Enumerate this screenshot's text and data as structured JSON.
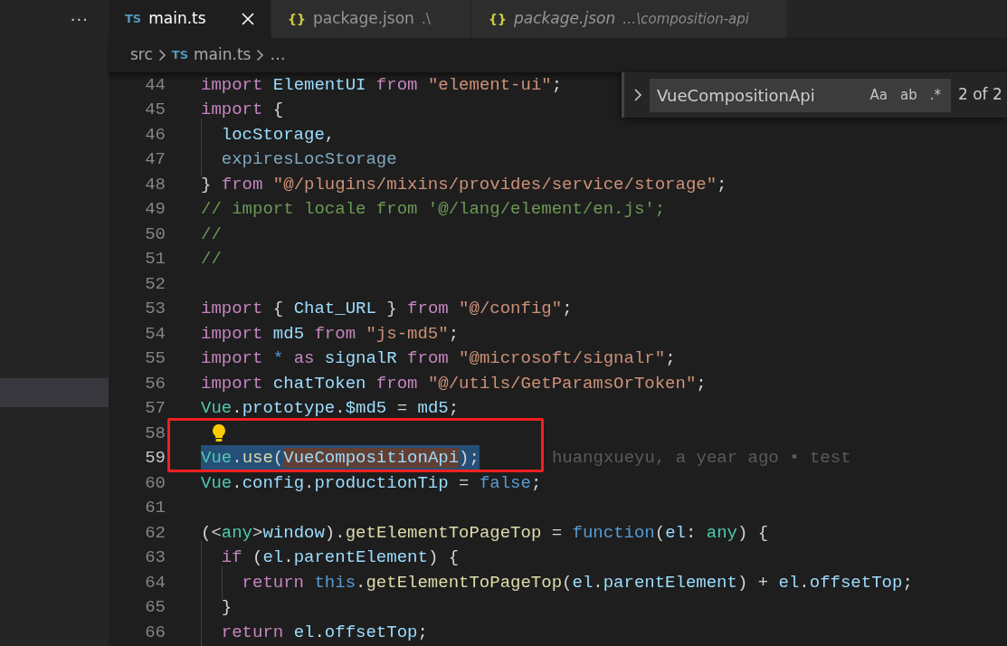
{
  "activity": {
    "more_actions": "···"
  },
  "tabs": [
    {
      "badge": {
        "text": "TS",
        "kind": "ts"
      },
      "label": "main.ts",
      "selected": true,
      "preview": false
    },
    {
      "badge": {
        "text": "{}",
        "kind": "json"
      },
      "label": "package.json",
      "description": ".\\",
      "selected": false,
      "preview": false
    },
    {
      "badge": {
        "text": "{}",
        "kind": "json"
      },
      "label": "package.json",
      "description": "…\\composition-api",
      "selected": false,
      "preview": true
    }
  ],
  "breadcrumb": [
    {
      "label": "src"
    },
    {
      "badge": {
        "text": "TS",
        "kind": "ts"
      },
      "label": "main.ts"
    },
    {
      "label": "…"
    }
  ],
  "find": {
    "value": "VueCompositionApi",
    "toggles": [
      {
        "label": "Aa",
        "on": false
      },
      {
        "label": "ab",
        "on": false
      },
      {
        "label": ".*",
        "on": false
      }
    ],
    "count": "2 of 2"
  },
  "lines": [
    {
      "number": "44",
      "selected": false,
      "boxed": false,
      "tokens": [
        {
          "t": "import ",
          "kind": "kw"
        },
        {
          "t": "ElementUI ",
          "kind": "var"
        },
        {
          "t": "from ",
          "kind": "kw"
        },
        {
          "t": "\"element-ui\"",
          "kind": "str"
        },
        {
          "t": ";",
          "kind": "p"
        }
      ]
    },
    {
      "number": "45",
      "selected": false,
      "boxed": false,
      "tokens": [
        {
          "t": "import",
          "kind": "kw"
        },
        {
          "t": " {",
          "kind": "p"
        }
      ]
    },
    {
      "number": "46",
      "selected": false,
      "boxed": false,
      "tokens": [
        {
          "t": "  locStorage",
          "kind": "var"
        },
        {
          "t": ",",
          "kind": "p"
        }
      ]
    },
    {
      "number": "47",
      "selected": false,
      "boxed": false,
      "tokens": [
        {
          "t": "  expiresLocStorage",
          "kind": "dim"
        }
      ]
    },
    {
      "number": "48",
      "selected": false,
      "boxed": false,
      "tokens": [
        {
          "t": "} ",
          "kind": "p"
        },
        {
          "t": "from ",
          "kind": "kw"
        },
        {
          "t": "\"@/plugins/mixins/provides/service/storage\"",
          "kind": "str"
        },
        {
          "t": ";",
          "kind": "p"
        }
      ]
    },
    {
      "number": "49",
      "selected": false,
      "boxed": false,
      "tokens": [
        {
          "t": "// import locale from '@/lang/element/en.js';",
          "kind": "com"
        }
      ]
    },
    {
      "number": "50",
      "selected": false,
      "boxed": false,
      "tokens": [
        {
          "t": "//",
          "kind": "com"
        }
      ]
    },
    {
      "number": "51",
      "selected": false,
      "boxed": false,
      "tokens": [
        {
          "t": "//",
          "kind": "com"
        }
      ]
    },
    {
      "number": "52",
      "selected": false,
      "boxed": false
    },
    {
      "number": "53",
      "selected": false,
      "boxed": false,
      "tokens": [
        {
          "t": "import",
          "kind": "kw"
        },
        {
          "t": " { ",
          "kind": "p"
        },
        {
          "t": "Chat_URL",
          "kind": "var"
        },
        {
          "t": " } ",
          "kind": "p"
        },
        {
          "t": "from ",
          "kind": "kw"
        },
        {
          "t": "\"@/config\"",
          "kind": "str"
        },
        {
          "t": ";",
          "kind": "p"
        }
      ]
    },
    {
      "number": "54",
      "selected": false,
      "boxed": false,
      "tokens": [
        {
          "t": "import ",
          "kind": "kw"
        },
        {
          "t": "md5 ",
          "kind": "var"
        },
        {
          "t": "from ",
          "kind": "kw"
        },
        {
          "t": "\"js-md5\"",
          "kind": "str"
        },
        {
          "t": ";",
          "kind": "p"
        }
      ]
    },
    {
      "number": "55",
      "selected": false,
      "boxed": false,
      "tokens": [
        {
          "t": "import ",
          "kind": "kw"
        },
        {
          "t": "* ",
          "kind": "kw2"
        },
        {
          "t": "as ",
          "kind": "kw"
        },
        {
          "t": "signalR ",
          "kind": "var"
        },
        {
          "t": "from ",
          "kind": "kw"
        },
        {
          "t": "\"@microsoft/signalr\"",
          "kind": "str"
        },
        {
          "t": ";",
          "kind": "p"
        }
      ]
    },
    {
      "number": "56",
      "selected": false,
      "boxed": false,
      "tokens": [
        {
          "t": "import ",
          "kind": "kw"
        },
        {
          "t": "chatToken ",
          "kind": "var"
        },
        {
          "t": "from ",
          "kind": "kw"
        },
        {
          "t": "\"@/utils/GetParamsOrToken\"",
          "kind": "str"
        },
        {
          "t": ";",
          "kind": "p"
        }
      ]
    },
    {
      "number": "57",
      "selected": false,
      "boxed": false,
      "tokens": [
        {
          "t": "Vue",
          "kind": "type"
        },
        {
          "t": ".",
          "kind": "p"
        },
        {
          "t": "prototype",
          "kind": "var"
        },
        {
          "t": ".",
          "kind": "p"
        },
        {
          "t": "$md5",
          "kind": "var"
        },
        {
          "t": " = ",
          "kind": "p"
        },
        {
          "t": "md5",
          "kind": "var"
        },
        {
          "t": ";",
          "kind": "p"
        }
      ]
    },
    {
      "number": "58",
      "selected": false,
      "boxed": true,
      "lightbulb": true
    },
    {
      "number": "59",
      "selected": true,
      "boxed": true,
      "blame": "huangxueyu, a year ago • test",
      "tokens": [
        {
          "t": "Vue",
          "kind": "type"
        },
        {
          "t": ".",
          "kind": "p"
        },
        {
          "t": "use",
          "kind": "fn"
        },
        {
          "t": "(",
          "kind": "p"
        },
        {
          "t": "VueCompositionApi",
          "kind": "var",
          "match": true
        },
        {
          "t": ");",
          "kind": "p"
        }
      ]
    },
    {
      "number": "60",
      "selected": false,
      "boxed": false,
      "tokens": [
        {
          "t": "Vue",
          "kind": "type"
        },
        {
          "t": ".",
          "kind": "p"
        },
        {
          "t": "config",
          "kind": "var"
        },
        {
          "t": ".",
          "kind": "p"
        },
        {
          "t": "productionTip",
          "kind": "var"
        },
        {
          "t": " = ",
          "kind": "p"
        },
        {
          "t": "false",
          "kind": "kw2"
        },
        {
          "t": ";",
          "kind": "p"
        }
      ]
    },
    {
      "number": "61",
      "selected": false,
      "boxed": false
    },
    {
      "number": "62",
      "selected": false,
      "boxed": false,
      "tokens": [
        {
          "t": "(<",
          "kind": "p"
        },
        {
          "t": "any",
          "kind": "type"
        },
        {
          "t": ">",
          "kind": "p"
        },
        {
          "t": "window",
          "kind": "var"
        },
        {
          "t": ").",
          "kind": "p"
        },
        {
          "t": "getElementToPageTop",
          "kind": "fn"
        },
        {
          "t": " = ",
          "kind": "p"
        },
        {
          "t": "function",
          "kind": "kw2"
        },
        {
          "t": "(",
          "kind": "p"
        },
        {
          "t": "el",
          "kind": "var"
        },
        {
          "t": ": ",
          "kind": "p"
        },
        {
          "t": "any",
          "kind": "type"
        },
        {
          "t": ") {",
          "kind": "p"
        }
      ]
    },
    {
      "number": "63",
      "selected": false,
      "boxed": false,
      "tokens": [
        {
          "t": "  if",
          "kind": "kw"
        },
        {
          "t": " (",
          "kind": "p"
        },
        {
          "t": "el",
          "kind": "var"
        },
        {
          "t": ".",
          "kind": "p"
        },
        {
          "t": "parentElement",
          "kind": "var"
        },
        {
          "t": ") {",
          "kind": "p"
        }
      ]
    },
    {
      "number": "64",
      "selected": false,
      "boxed": false,
      "tokens": [
        {
          "t": "    return ",
          "kind": "kw"
        },
        {
          "t": "this",
          "kind": "kw2"
        },
        {
          "t": ".",
          "kind": "p"
        },
        {
          "t": "getElementToPageTop",
          "kind": "fn"
        },
        {
          "t": "(",
          "kind": "p"
        },
        {
          "t": "el",
          "kind": "var"
        },
        {
          "t": ".",
          "kind": "p"
        },
        {
          "t": "parentElement",
          "kind": "var"
        },
        {
          "t": ") + ",
          "kind": "p"
        },
        {
          "t": "el",
          "kind": "var"
        },
        {
          "t": ".",
          "kind": "p"
        },
        {
          "t": "offsetTop",
          "kind": "var"
        },
        {
          "t": ";",
          "kind": "p"
        }
      ]
    },
    {
      "number": "65",
      "selected": false,
      "boxed": false,
      "tokens": [
        {
          "t": "  }",
          "kind": "p"
        }
      ]
    },
    {
      "number": "66",
      "selected": false,
      "boxed": false,
      "tokens": [
        {
          "t": "  return ",
          "kind": "kw"
        },
        {
          "t": "el",
          "kind": "var"
        },
        {
          "t": ".",
          "kind": "p"
        },
        {
          "t": "offsetTop",
          "kind": "var"
        },
        {
          "t": ";",
          "kind": "p"
        }
      ]
    }
  ]
}
